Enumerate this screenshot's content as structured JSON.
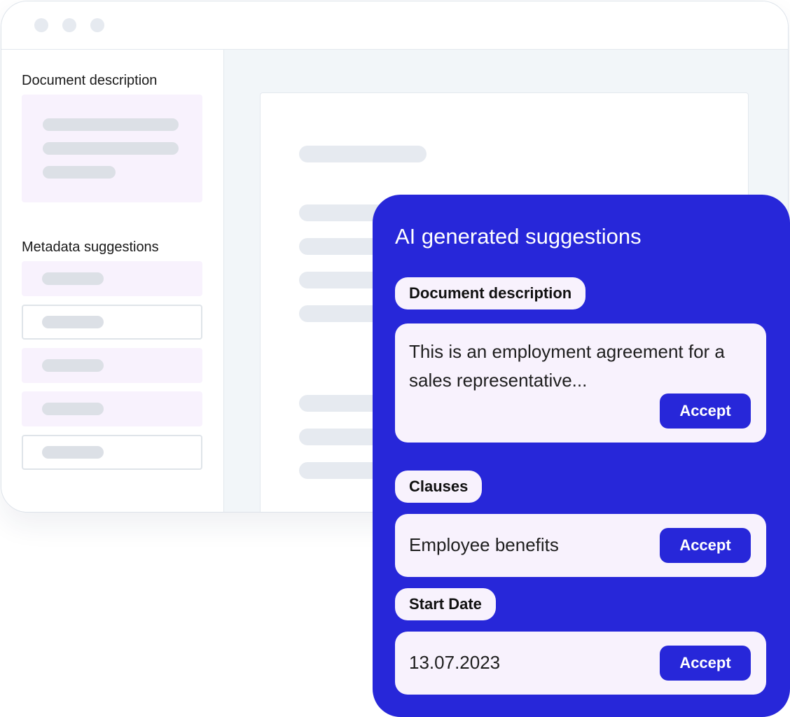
{
  "sidebar": {
    "document_description_label": "Document description",
    "metadata_suggestions_label": "Metadata suggestions"
  },
  "ai_panel": {
    "title": "AI generated suggestions",
    "sections": [
      {
        "label": "Document description",
        "value": "This is an employment agreement for a sales representative...",
        "accept_label": "Accept"
      },
      {
        "label": "Clauses",
        "value": "Employee benefits",
        "accept_label": "Accept"
      },
      {
        "label": "Start Date",
        "value": "13.07.2023",
        "accept_label": "Accept"
      }
    ]
  },
  "colors": {
    "accent": "#2727d9",
    "card_background": "#f8f2fd",
    "skeleton": "#dce0e6",
    "content_background": "#f2f6f9"
  }
}
